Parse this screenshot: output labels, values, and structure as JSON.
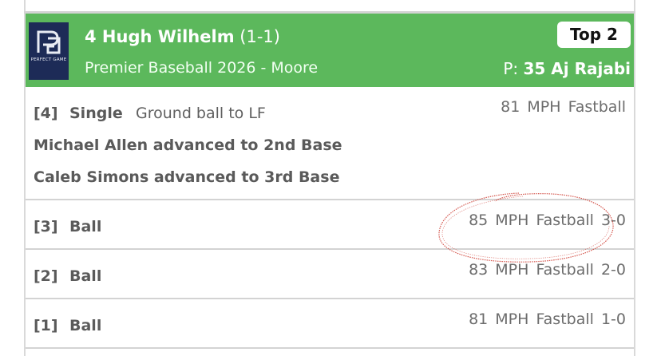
{
  "header": {
    "logo_text": "PERFECT GAME",
    "batter_name": "4 Hugh Wilhelm",
    "batter_record": "(1-1)",
    "team": "Premier Baseball 2026 - Moore",
    "inning": "Top 2",
    "pitcher_prefix": "P:",
    "pitcher_name": "35 Aj Rajabi"
  },
  "pitches": [
    {
      "num": "[4]",
      "result": "Single",
      "description": "Ground ball to LF",
      "speed": "81 MPH",
      "pitch_type": "Fastball",
      "count": "",
      "extra": [
        "Michael Allen advanced to 2nd Base",
        "Caleb Simons advanced to 3rd Base"
      ]
    },
    {
      "num": "[3]",
      "result": "Ball",
      "description": "",
      "speed": "85 MPH",
      "pitch_type": "Fastball",
      "count": "3-0",
      "extra": []
    },
    {
      "num": "[2]",
      "result": "Ball",
      "description": "",
      "speed": "83 MPH",
      "pitch_type": "Fastball",
      "count": "2-0",
      "extra": []
    },
    {
      "num": "[1]",
      "result": "Ball",
      "description": "",
      "speed": "81 MPH",
      "pitch_type": "Fastball",
      "count": "1-0",
      "extra": []
    }
  ],
  "colors": {
    "header_bg": "#5cb85c",
    "annotation": "#d0463c"
  }
}
